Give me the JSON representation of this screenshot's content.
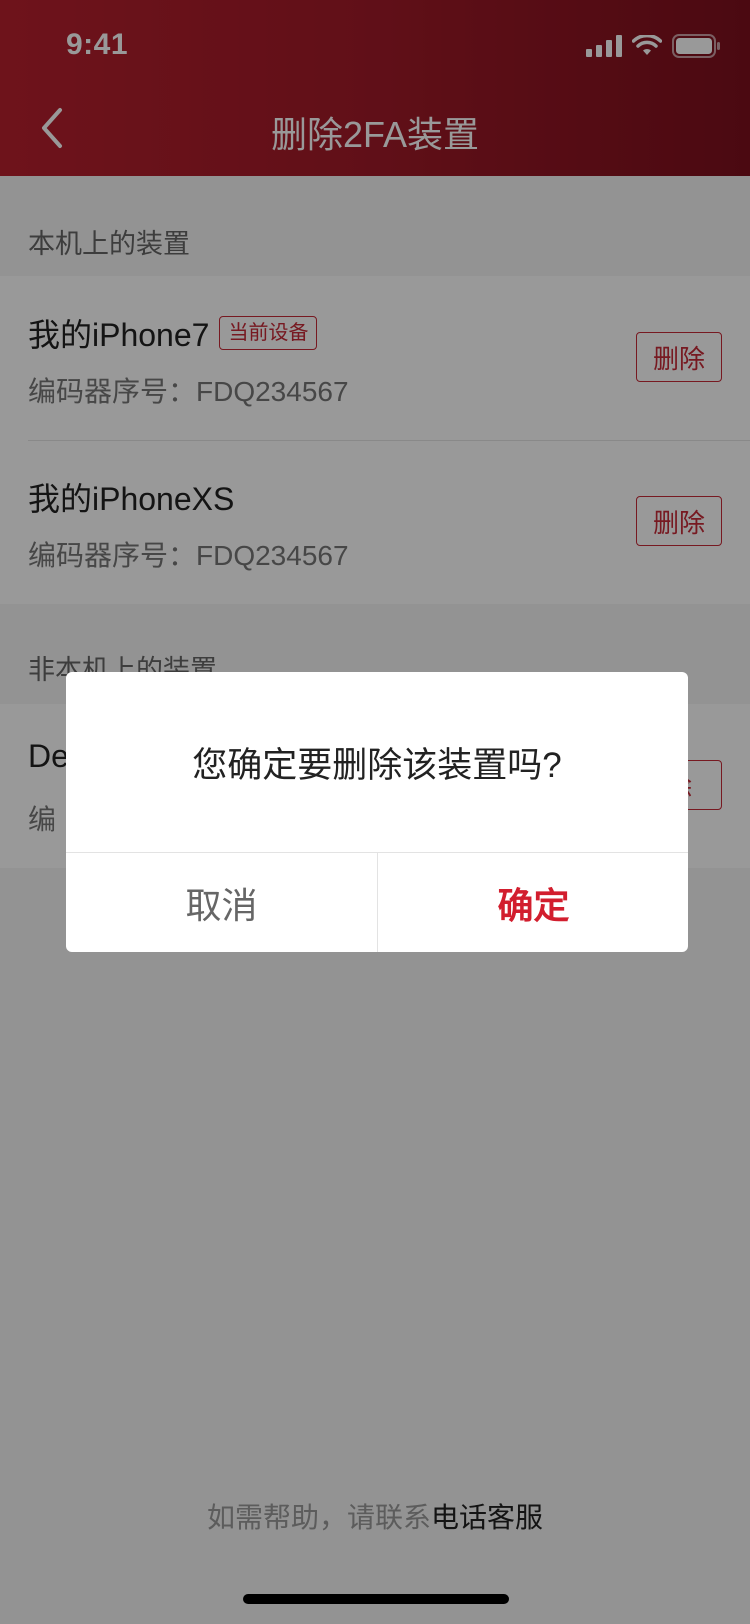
{
  "status_bar": {
    "time": "9:41"
  },
  "nav": {
    "title": "删除2FA装置",
    "back_icon": "chevron-left-icon"
  },
  "section_local": {
    "label": "本机上的装置"
  },
  "local_devices": [
    {
      "name": "我的iPhone7",
      "badge": "当前设备",
      "serial": "编码器序号：FDQ234567",
      "delete_label": "删除"
    },
    {
      "name": "我的iPhoneXS",
      "serial": "编码器序号：FDQ234567",
      "delete_label": "删除"
    }
  ],
  "section_other": {
    "label": "非本机上的装置"
  },
  "other_devices": [
    {
      "name": "De",
      "serial": "编",
      "delete_label": "除"
    }
  ],
  "help": {
    "prefix": "如需帮助，请联系",
    "link": "电话客服"
  },
  "dialog": {
    "message": "您确定要删除该装置吗?",
    "cancel": "取消",
    "confirm": "确定"
  },
  "colors": {
    "brand_red": "#b8202e",
    "accent_red": "#d21e2e",
    "overlay": "rgba(0,0,0,0.40)"
  }
}
